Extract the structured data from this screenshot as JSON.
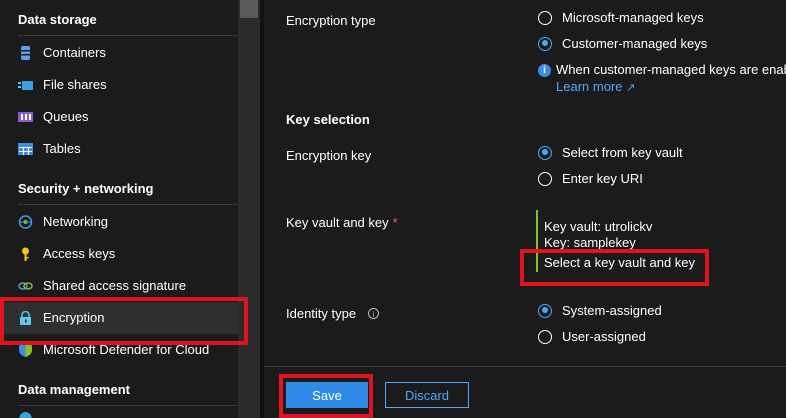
{
  "sidebar": {
    "sections": [
      {
        "title": "Data storage",
        "items": [
          {
            "label": "Containers",
            "icon": "containers-icon"
          },
          {
            "label": "File shares",
            "icon": "file-shares-icon"
          },
          {
            "label": "Queues",
            "icon": "queues-icon"
          },
          {
            "label": "Tables",
            "icon": "tables-icon"
          }
        ]
      },
      {
        "title": "Security + networking",
        "items": [
          {
            "label": "Networking",
            "icon": "networking-icon"
          },
          {
            "label": "Access keys",
            "icon": "key-icon"
          },
          {
            "label": "Shared access signature",
            "icon": "link-icon"
          },
          {
            "label": "Encryption",
            "icon": "lock-icon",
            "selected": true
          },
          {
            "label": "Microsoft Defender for Cloud",
            "icon": "shield-icon"
          }
        ]
      },
      {
        "title": "Data management",
        "items": []
      }
    ]
  },
  "encryption_type": {
    "label": "Encryption type",
    "options": [
      "Microsoft-managed keys",
      "Customer-managed keys"
    ],
    "selected": "Customer-managed keys",
    "info_text": "When customer-managed keys are enab",
    "learn_more": "Learn more"
  },
  "key_selection": {
    "heading": "Key selection",
    "encryption_key_label": "Encryption key",
    "encryption_key_options": [
      "Select from key vault",
      "Enter key URI"
    ],
    "encryption_key_selected": "Select from key vault",
    "key_vault_label": "Key vault and key",
    "required_mark": "*",
    "key_vault_line": "Key vault: utrolickv",
    "key_line": "Key: samplekey",
    "select_link": "Select a key vault and key",
    "identity_label": "Identity type",
    "identity_options": [
      "System-assigned",
      "User-assigned"
    ],
    "identity_selected": "System-assigned"
  },
  "footer": {
    "save_label": "Save",
    "discard_label": "Discard"
  },
  "colors": {
    "accent": "#2e8ae6",
    "link": "#4aa8ff",
    "highlight": "#e0141e",
    "kv_bar": "#8cbf26"
  }
}
